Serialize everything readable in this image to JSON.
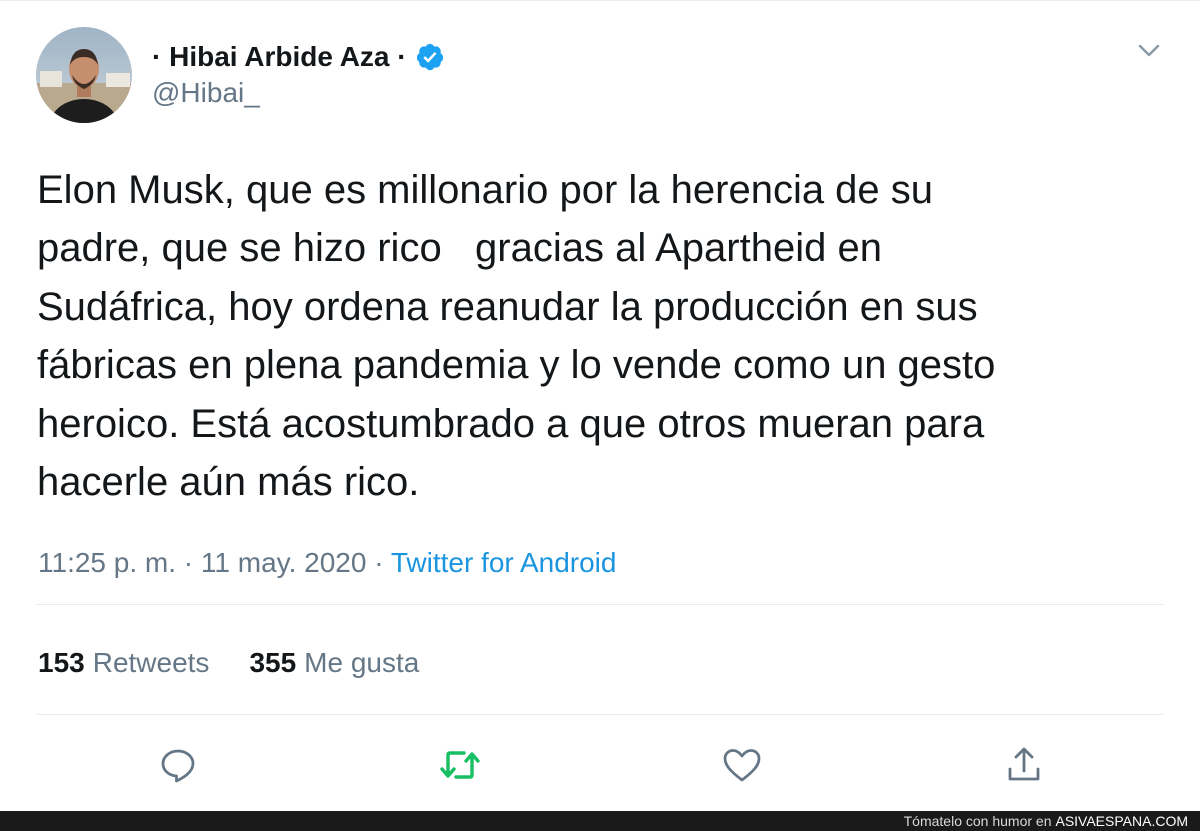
{
  "tweet": {
    "author": {
      "display_name": "· Hibai Arbide Aza ·",
      "handle": "@Hibai_",
      "verified": true
    },
    "text": "Elon Musk, que es millonario por la herencia de su\npadre, que se hizo rico   gracias al Apartheid en\nSudáfrica, hoy ordena reanudar la producción en sus\nfábricas en plena pandemia y lo vende como un gesto\nheroico. Está acostumbrado a que otros mueran para\nhacerle aún más rico.",
    "time": "11:25 p. m.",
    "date": "11 may. 2020",
    "source": "Twitter for Android",
    "retweets_count": "153",
    "retweets_label": "Retweets",
    "likes_count": "355",
    "likes_label": "Me gusta",
    "icons": {
      "menu": "chevron-down-icon",
      "reply": "reply-icon",
      "retweet": "retweet-icon",
      "like": "heart-icon",
      "share": "share-icon"
    }
  },
  "footer": {
    "prefix": "Tómatelo con humor en",
    "brand": "ASIVAESPANA.COM"
  },
  "colors": {
    "primary_text": "#14171a",
    "secondary_text": "#657786",
    "link": "#1b95e0",
    "verified": "#1da1f2",
    "retweet_icon": "#17bf63",
    "footer_bg": "#1a1a1a"
  }
}
